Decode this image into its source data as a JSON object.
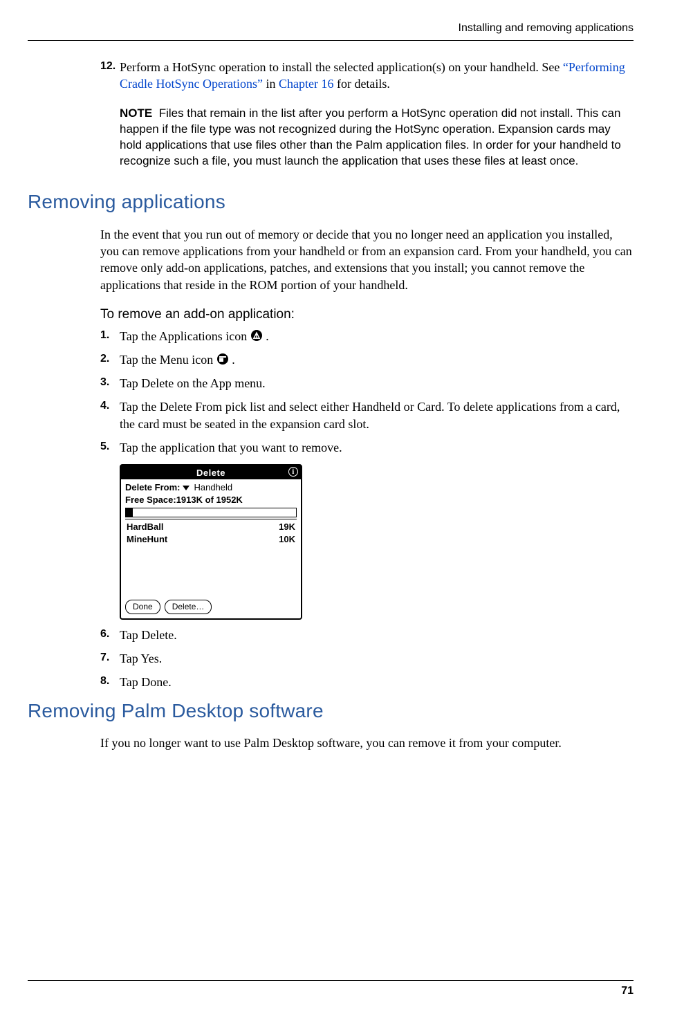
{
  "running_head": "Installing and removing applications",
  "page_number": "71",
  "step12": {
    "num": "12.",
    "text_a": "Perform a HotSync operation to install the selected application(s) on your handheld. See ",
    "link1": "“Performing Cradle HotSync Operations”",
    "text_b": " in ",
    "link2": "Chapter 16",
    "text_c": " for details."
  },
  "note": {
    "label": "NOTE",
    "text": "Files that remain in the list after you perform a HotSync operation did not install. This can happen if the file type was not recognized during the HotSync operation. Expansion cards may hold applications that use files other than the Palm application files. In order for your handheld to recognize such a file, you must launch the application that uses these files at least once."
  },
  "removing_apps": {
    "heading": "Removing applications",
    "intro": "In the event that you run out of memory or decide that you no longer need an application you installed, you can remove applications from your handheld or from an expansion card. From your handheld, you can remove only add-on applications, patches, and extensions that you install; you cannot remove the applications that reside in the ROM portion of your handheld.",
    "subhead": "To remove an add-on application:",
    "steps": [
      {
        "num": "1.",
        "text": "Tap the Applications icon ",
        "icon": "home",
        "tail": " ."
      },
      {
        "num": "2.",
        "text": "Tap the Menu icon ",
        "icon": "menu",
        "tail": " ."
      },
      {
        "num": "3.",
        "text": "Tap Delete on the App menu."
      },
      {
        "num": "4.",
        "text": "Tap the Delete From pick list and select either Handheld or Card. To delete applications from a card, the card must be seated in the expansion card slot."
      },
      {
        "num": "5.",
        "text": "Tap the application that you want to remove."
      }
    ],
    "steps_after": [
      {
        "num": "6.",
        "text": "Tap Delete."
      },
      {
        "num": "7.",
        "text": "Tap Yes."
      },
      {
        "num": "8.",
        "text": "Tap Done."
      }
    ]
  },
  "palm": {
    "title": "Delete",
    "from_label": "Delete From:",
    "from_value": "Handheld",
    "free_space": "Free Space:1913K of 1952K",
    "items": [
      {
        "name": "HardBall",
        "size": "19K"
      },
      {
        "name": "MineHunt",
        "size": "10K"
      }
    ],
    "done": "Done",
    "delete": "Delete…"
  },
  "removing_desktop": {
    "heading": "Removing Palm Desktop software",
    "intro": "If you no longer want to use Palm Desktop software, you can remove it from your computer."
  }
}
